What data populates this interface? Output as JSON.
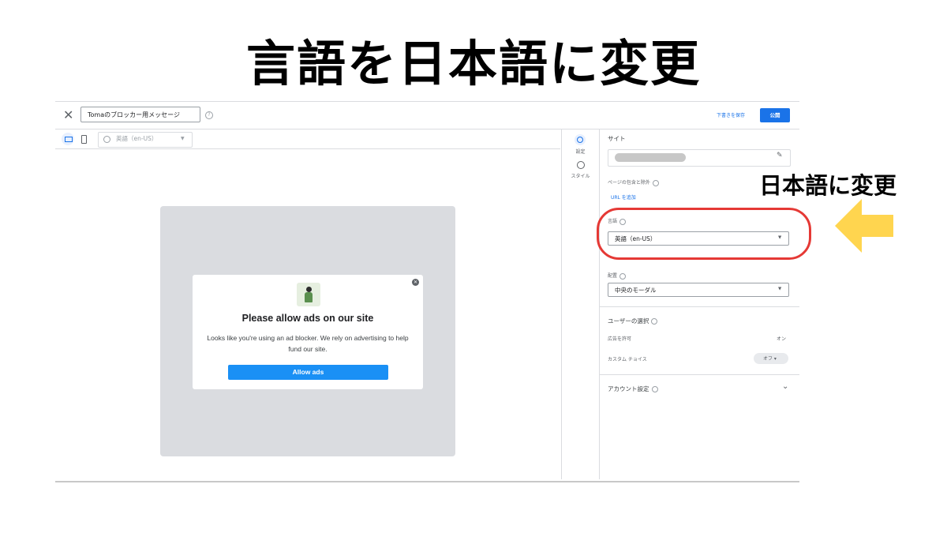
{
  "headline": "言語を日本語に変更",
  "annotation": {
    "note": "日本語に変更",
    "arrow_color": "#FFD54F",
    "ring_color": "#E53935"
  },
  "topbar": {
    "close_icon": "close-icon",
    "message_name": "Tomaのブロッカー用メッセージ",
    "draft_label": "下書きを保存",
    "publish_label": "公開"
  },
  "toolbar": {
    "device_icons": [
      "desktop-icon",
      "mobile-icon"
    ],
    "preview_language": "英語（en-US）"
  },
  "dialog": {
    "title": "Please allow ads on our site",
    "body": "Looks like you're using an ad blocker. We rely on advertising to help fund our site.",
    "button_label": "Allow ads"
  },
  "rail": {
    "items": [
      {
        "label": "設定",
        "icon": "gear-icon"
      },
      {
        "label": "スタイル",
        "icon": "palette-icon"
      }
    ]
  },
  "panel": {
    "site_label": "サイト",
    "pages_label": "ページの包含と除外",
    "add_url_link": "URL を追加",
    "language_label": "言語",
    "language_value": "英語（en-US）",
    "placement_label": "配置",
    "placement_value": "中央のモーダル",
    "user_choice_label": "ユーザーの選択",
    "allow_ads_label": "広告を許可",
    "allow_ads_value": "オン",
    "custom_choice_label": "カスタム チョイス",
    "custom_choice_value": "オフ",
    "account_settings_label": "アカウント設定"
  },
  "colors": {
    "primary": "#1a73e8",
    "allow_button": "#1a90f5",
    "preview_bg": "#dadce0"
  }
}
